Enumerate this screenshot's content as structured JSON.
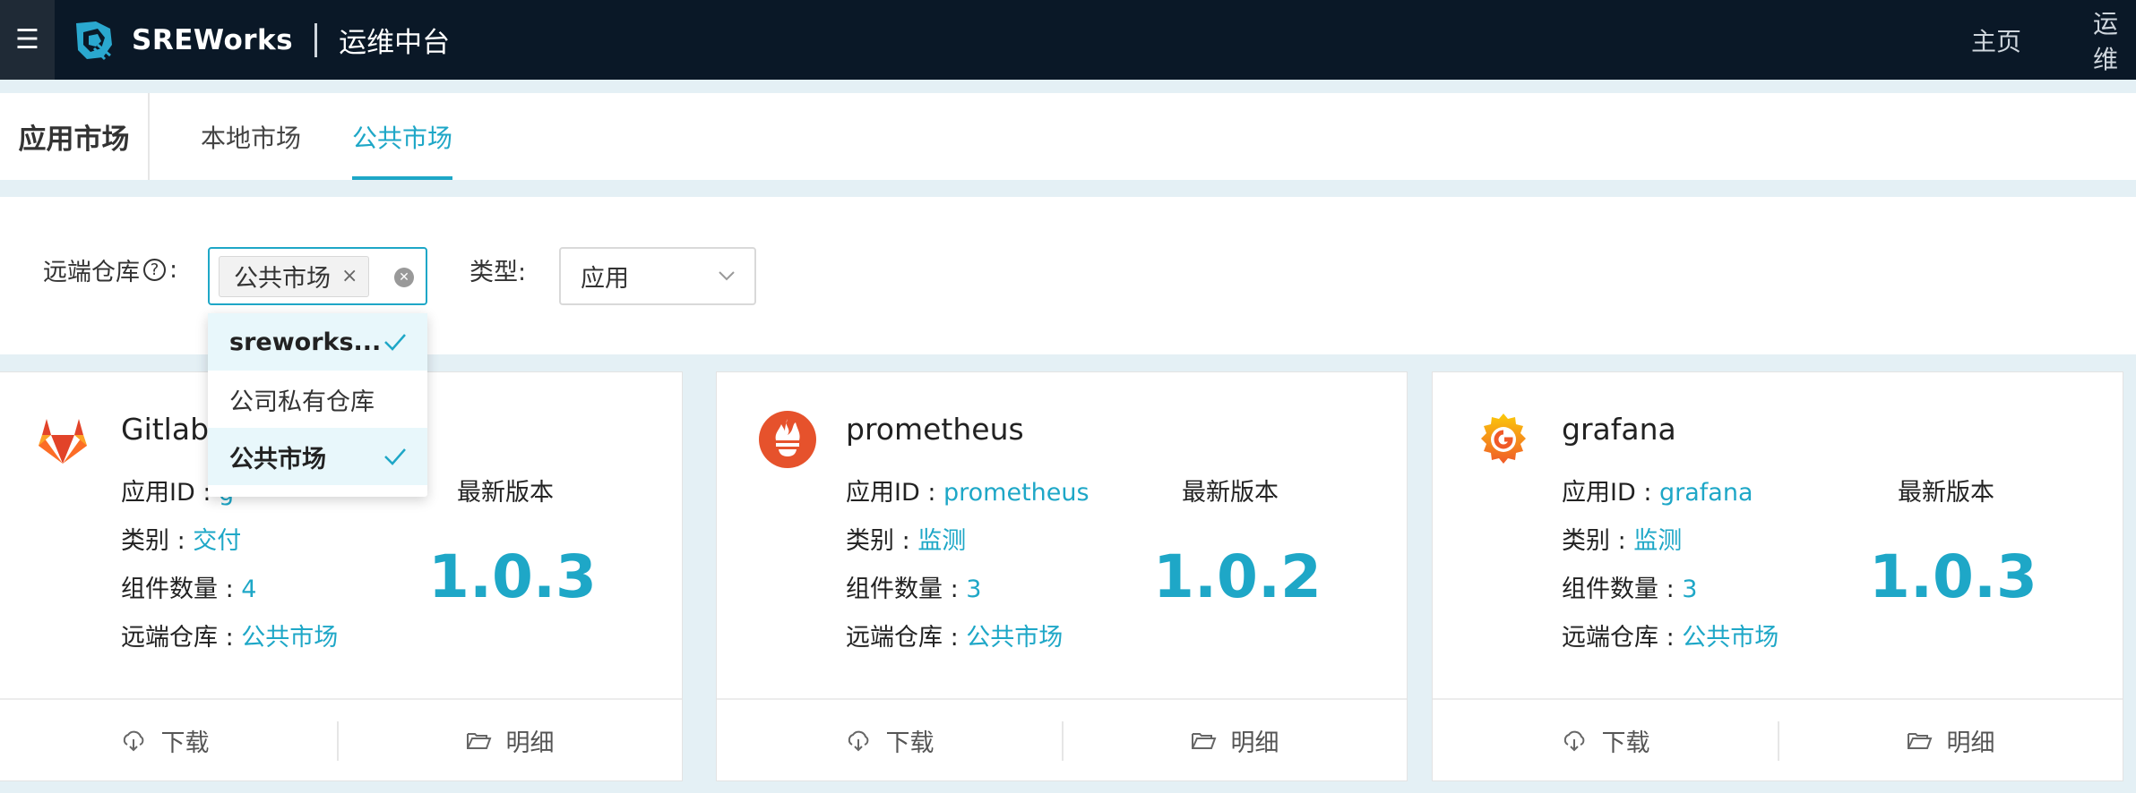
{
  "topbar": {
    "menu_icon": "hamburger-icon",
    "brand_name": "SREWorks",
    "brand_sub": "运维中台",
    "nav": [
      "主页",
      "运维"
    ]
  },
  "header": {
    "title": "应用市场",
    "tabs": [
      {
        "label": "本地市场",
        "active": false
      },
      {
        "label": "公共市场",
        "active": true
      }
    ]
  },
  "filters": {
    "remote_label_prefix": "远端仓库",
    "remote_label_suffix": ":",
    "remote_tag": "公共市场",
    "type_label": "类型:",
    "type_value": "应用"
  },
  "dropdown": {
    "items": [
      {
        "label": "sreworks...",
        "selected": true
      },
      {
        "label": "公司私有仓库",
        "selected": false
      },
      {
        "label": "公共市场",
        "selected": true
      }
    ]
  },
  "cards": [
    {
      "name": "Gitlab",
      "id_label": "应用ID : ",
      "id": "g",
      "category_label": "类别 : ",
      "category": "交付",
      "components_label": "组件数量 : ",
      "components": "4",
      "repo_label": "远端仓库 : ",
      "repo": "公共市场",
      "version_label": "最新版本",
      "version": "1.0.3",
      "download": "下载",
      "detail": "明细",
      "icon": "gitlab-icon"
    },
    {
      "name": "prometheus",
      "id_label": "应用ID : ",
      "id": "prometheus",
      "category_label": "类别 : ",
      "category": "监测",
      "components_label": "组件数量 : ",
      "components": "3",
      "repo_label": "远端仓库 : ",
      "repo": "公共市场",
      "version_label": "最新版本",
      "version": "1.0.2",
      "download": "下载",
      "detail": "明细",
      "icon": "prometheus-icon"
    },
    {
      "name": "grafana",
      "id_label": "应用ID : ",
      "id": "grafana",
      "category_label": "类别 : ",
      "category": "监测",
      "components_label": "组件数量 : ",
      "components": "3",
      "repo_label": "远端仓库 : ",
      "repo": "公共市场",
      "version_label": "最新版本",
      "version": "1.0.3",
      "download": "下载",
      "detail": "明细",
      "icon": "grafana-icon"
    }
  ],
  "colors": {
    "accent": "#1ea7c7",
    "topbar": "#0a1827",
    "page_bg": "#e4f0f5"
  }
}
